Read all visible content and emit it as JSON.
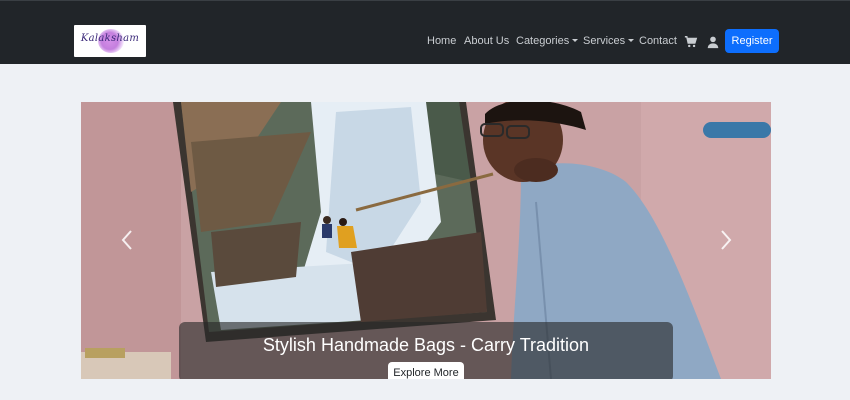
{
  "brand": {
    "logo_text": "Kalaksham"
  },
  "nav": {
    "home": "Home",
    "about": "About Us",
    "categories": "Categories",
    "services": "Services",
    "contact": "Contact",
    "cart_icon": "cart-icon",
    "user_icon": "user-icon",
    "register": "Register"
  },
  "hero": {
    "caption_title": "Stylish Handmade Bags - Carry Tradition",
    "button_label": "Explore More",
    "prev_icon": "chevron-left-icon",
    "next_icon": "chevron-right-icon",
    "image_subject": "mouth-painting artist with waterfall canvas"
  },
  "colors": {
    "navbar_bg": "#212529",
    "accent": "#0d6efd",
    "page_bg": "#eef1f5"
  }
}
